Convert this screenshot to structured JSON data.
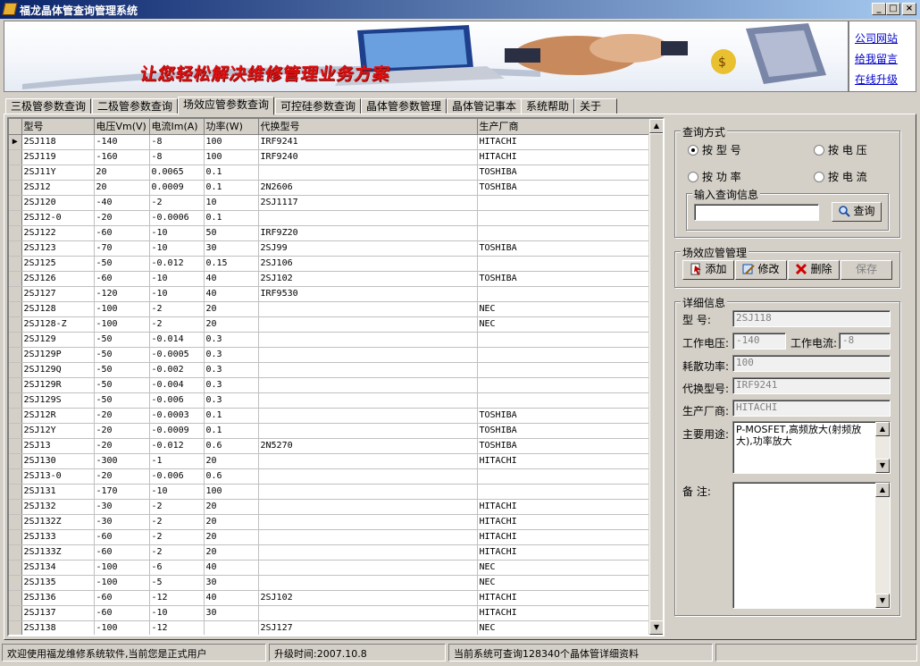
{
  "window": {
    "title": "福龙晶体管查询管理系统",
    "minimize": "_",
    "maximize": "□",
    "close": "×"
  },
  "banner": {
    "slogan": "让您轻松解决维修管理业务方案"
  },
  "links": [
    {
      "label": "公司网站"
    },
    {
      "label": "给我留言"
    },
    {
      "label": "在线升级"
    }
  ],
  "tabs": [
    {
      "label": "三极管参数查询"
    },
    {
      "label": "二极管参数查询"
    },
    {
      "label": "场效应管参数查询",
      "active": true
    },
    {
      "label": "可控硅参数查询"
    },
    {
      "label": "晶体管参数管理"
    },
    {
      "label": "晶体管记事本"
    },
    {
      "label": "系统帮助"
    },
    {
      "label": "关于"
    }
  ],
  "grid": {
    "columns": [
      "型号",
      "电压Vm(V)",
      "电流Im(A)",
      "功率(W)",
      "代换型号",
      "生产厂商"
    ],
    "selected_row": 0,
    "rows": [
      [
        "2SJ118",
        "-140",
        "-8",
        "100",
        "IRF9241",
        "HITACHI"
      ],
      [
        "2SJ119",
        "-160",
        "-8",
        "100",
        "IRF9240",
        "HITACHI"
      ],
      [
        "2SJ11Y",
        "20",
        "0.0065",
        "0.1",
        "",
        "TOSHIBA"
      ],
      [
        "2SJ12",
        "20",
        "0.0009",
        "0.1",
        "2N2606",
        "TOSHIBA"
      ],
      [
        "2SJ120",
        "-40",
        "-2",
        "10",
        "2SJ1117",
        ""
      ],
      [
        "2SJ12-0",
        "-20",
        "-0.0006",
        "0.1",
        "",
        ""
      ],
      [
        "2SJ122",
        "-60",
        "-10",
        "50",
        "IRF9Z20",
        ""
      ],
      [
        "2SJ123",
        "-70",
        "-10",
        "30",
        "2SJ99",
        "TOSHIBA"
      ],
      [
        "2SJ125",
        "-50",
        "-0.012",
        "0.15",
        "2SJ106",
        ""
      ],
      [
        "2SJ126",
        "-60",
        "-10",
        "40",
        "2SJ102",
        "TOSHIBA"
      ],
      [
        "2SJ127",
        "-120",
        "-10",
        "40",
        "IRF9530",
        ""
      ],
      [
        "2SJ128",
        "-100",
        "-2",
        "20",
        "",
        "NEC"
      ],
      [
        "2SJ128-Z",
        "-100",
        "-2",
        "20",
        "",
        "NEC"
      ],
      [
        "2SJ129",
        "-50",
        "-0.014",
        "0.3",
        "",
        ""
      ],
      [
        "2SJ129P",
        "-50",
        "-0.0005",
        "0.3",
        "",
        ""
      ],
      [
        "2SJ129Q",
        "-50",
        "-0.002",
        "0.3",
        "",
        ""
      ],
      [
        "2SJ129R",
        "-50",
        "-0.004",
        "0.3",
        "",
        ""
      ],
      [
        "2SJ129S",
        "-50",
        "-0.006",
        "0.3",
        "",
        ""
      ],
      [
        "2SJ12R",
        "-20",
        "-0.0003",
        "0.1",
        "",
        "TOSHIBA"
      ],
      [
        "2SJ12Y",
        "-20",
        "-0.0009",
        "0.1",
        "",
        "TOSHIBA"
      ],
      [
        "2SJ13",
        "-20",
        "-0.012",
        "0.6",
        "2N5270",
        "TOSHIBA"
      ],
      [
        "2SJ130",
        "-300",
        "-1",
        "20",
        "",
        "HITACHI"
      ],
      [
        "2SJ13-0",
        "-20",
        "-0.006",
        "0.6",
        "",
        ""
      ],
      [
        "2SJ131",
        "-170",
        "-10",
        "100",
        "",
        ""
      ],
      [
        "2SJ132",
        "-30",
        "-2",
        "20",
        "",
        "HITACHI"
      ],
      [
        "2SJ132Z",
        "-30",
        "-2",
        "20",
        "",
        "HITACHI"
      ],
      [
        "2SJ133",
        "-60",
        "-2",
        "20",
        "",
        "HITACHI"
      ],
      [
        "2SJ133Z",
        "-60",
        "-2",
        "20",
        "",
        "HITACHI"
      ],
      [
        "2SJ134",
        "-100",
        "-6",
        "40",
        "",
        "NEC"
      ],
      [
        "2SJ135",
        "-100",
        "-5",
        "30",
        "",
        "NEC"
      ],
      [
        "2SJ136",
        "-60",
        "-12",
        "40",
        "2SJ102",
        "HITACHI"
      ],
      [
        "2SJ137",
        "-60",
        "-10",
        "30",
        "",
        "HITACHI"
      ],
      [
        "2SJ138",
        "-100",
        "-12",
        "",
        "2SJ127",
        "NEC"
      ]
    ]
  },
  "query": {
    "group_label": "查询方式",
    "options": [
      {
        "label": "按 型 号",
        "checked": true
      },
      {
        "label": "按 电 压",
        "checked": false
      },
      {
        "label": "按 功 率",
        "checked": false
      },
      {
        "label": "按 电 流",
        "checked": false
      }
    ],
    "input_group_label": "输入查询信息",
    "input_value": "",
    "search_button": "查询"
  },
  "manage": {
    "group_label": "场效应管管理",
    "add": "添加",
    "edit": "修改",
    "delete": "删除",
    "save": "保存"
  },
  "detail": {
    "group_label": "详细信息",
    "model_label": "型    号:",
    "model": "2SJ118",
    "voltage_label": "工作电压:",
    "voltage": "-140",
    "current_label": "工作电流:",
    "current": "-8",
    "power_label": "耗散功率:",
    "power": "100",
    "sub_label": "代换型号:",
    "sub": "IRF9241",
    "maker_label": "生产厂商:",
    "maker": "HITACHI",
    "usage_label": "主要用途:",
    "usage": "P-MOSFET,高频放大(射频放大),功率放大",
    "note_label": "备    注:",
    "note": ""
  },
  "status": {
    "welcome": "欢迎使用福龙维修系统软件,当前您是正式用户",
    "upgrade": "升级时间:2007.10.8",
    "count": "当前系统可查询128340个晶体管详细资料"
  }
}
